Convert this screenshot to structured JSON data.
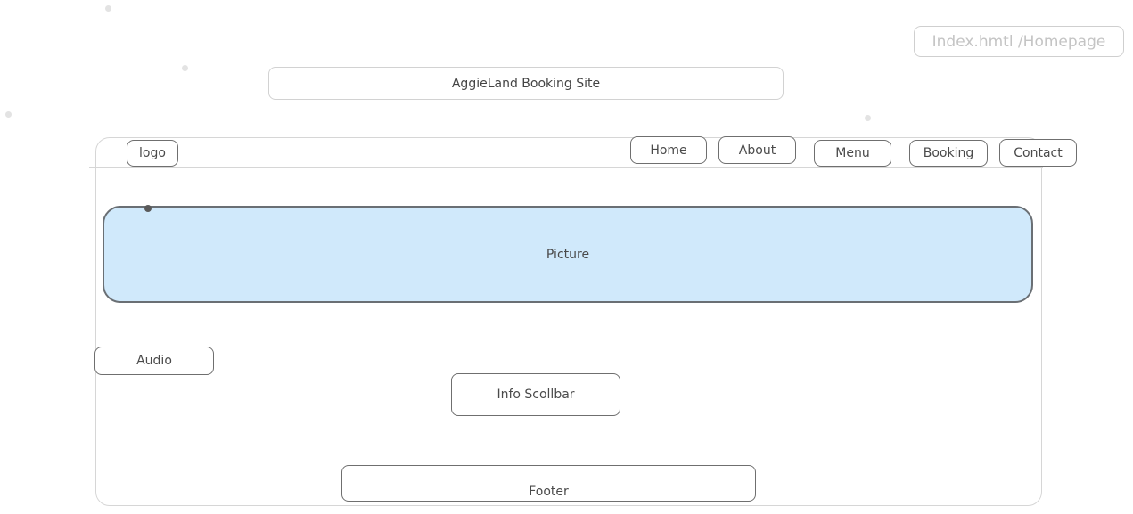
{
  "page_label": "Index.hmtl /Homepage",
  "site_title": "AggieLand Booking Site",
  "header": {
    "logo": "logo",
    "nav": {
      "home": "Home",
      "about": "About",
      "menu": "Menu",
      "booking": "Booking",
      "contact": "Contact"
    }
  },
  "main": {
    "picture": "Picture",
    "audio": "Audio",
    "info_scrollbar": "Info Scollbar"
  },
  "footer": {
    "label": "Footer"
  },
  "colors": {
    "picture_fill": "#d0e9fb",
    "stroke": "#6f6f6f",
    "faint_stroke": "#cfcfcf"
  }
}
